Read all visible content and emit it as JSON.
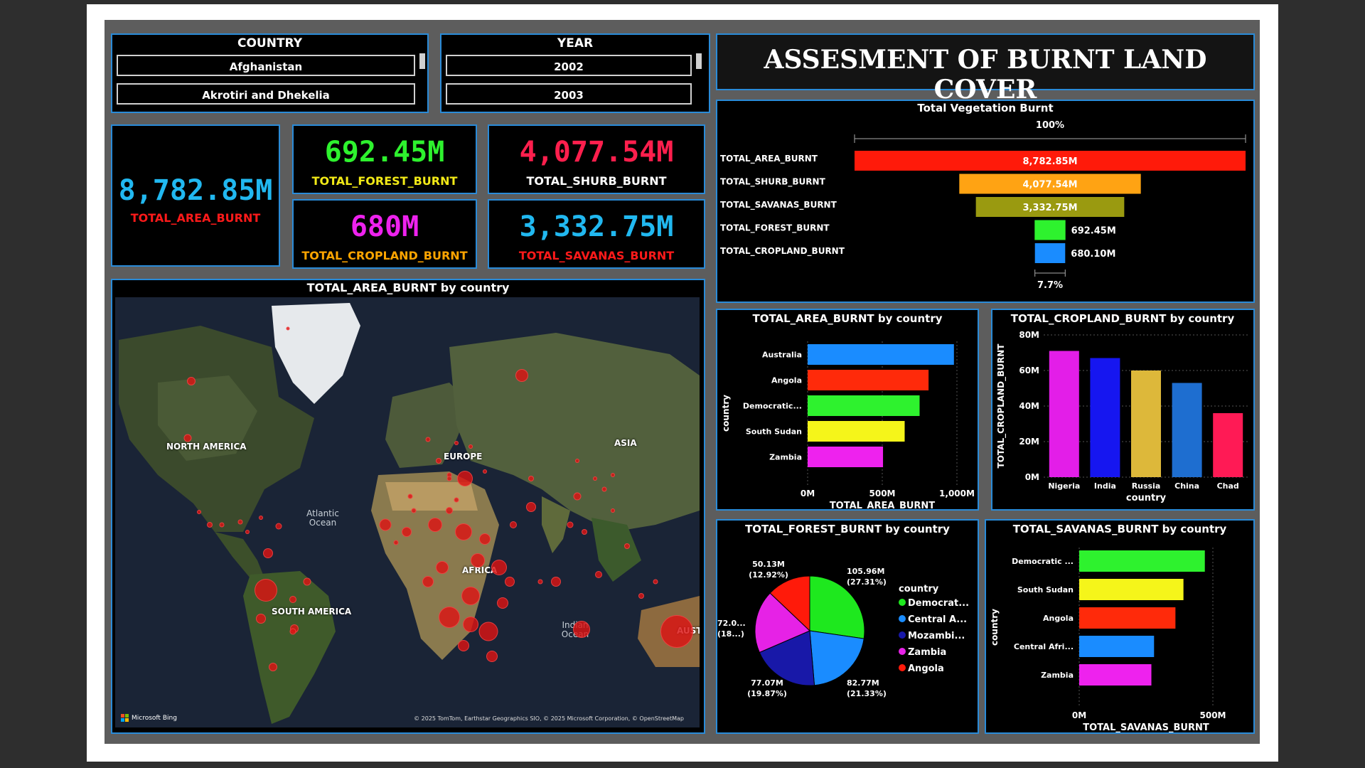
{
  "dashboard_title": "ASSESMENT OF BURNT LAND COVER",
  "slicers": {
    "country": {
      "title": "COUNTRY",
      "items": [
        "Afghanistan",
        "Akrotiri and Dhekelia"
      ]
    },
    "year": {
      "title": "YEAR",
      "items": [
        "2002",
        "2003"
      ]
    }
  },
  "kpis": {
    "area": {
      "value": "8,782.85M",
      "label": "TOTAL_AREA_BURNT",
      "value_color": "#21b8f0",
      "label_color": "#ff1a1a"
    },
    "forest": {
      "value": "692.45M",
      "label": "TOTAL_FOREST_BURNT",
      "value_color": "#2ef22e",
      "label_color": "#f2ea17"
    },
    "shrub": {
      "value": "4,077.54M",
      "label": "TOTAL_SHURB_BURNT",
      "value_color": "#ff1f4d",
      "label_color": "#ffffff"
    },
    "cropland": {
      "value": "680M",
      "label": "TOTAL_CROPLAND_BURNT",
      "value_color": "#ee22ee",
      "label_color": "#ffa500"
    },
    "savanas": {
      "value": "3,332.75M",
      "label": "TOTAL_SAVANAS_BURNT",
      "value_color": "#21b8f0",
      "label_color": "#ff1a1a"
    }
  },
  "map": {
    "title": "TOTAL_AREA_BURNT by country",
    "labels": {
      "north_america": "NORTH AMERICA",
      "europe": "EUROPE",
      "asia": "ASIA",
      "africa": "AFRICA",
      "south_america": "SOUTH AMERICA",
      "australia": "AUSTR",
      "atlantic": "Atlantic Ocean",
      "indian": "Indian Ocean"
    },
    "logo": "Microsoft Bing",
    "attribution": "© 2025 TomTom, Earthstar Geographics SIO, © 2025 Microsoft Corporation, © OpenStreetMap"
  },
  "chart_data": [
    {
      "type": "bar",
      "title": "Total Vegetation Burnt",
      "top_label": "100%",
      "bottom_label": "7.7%",
      "categories": [
        "TOTAL_AREA_BURNT",
        "TOTAL_SHURB_BURNT",
        "TOTAL_SAVANAS_BURNT",
        "TOTAL_FOREST_BURNT",
        "TOTAL_CROPLAND_BURNT"
      ],
      "values": [
        8782.85,
        4077.54,
        3332.75,
        692.45,
        680.1
      ],
      "value_labels": [
        "8,782.85M",
        "4,077.54M",
        "3,332.75M",
        "692.45M",
        "680.10M"
      ],
      "colors": [
        "#ff1a0a",
        "#ffa313",
        "#9a9a10",
        "#2ef22e",
        "#1a8cff"
      ]
    },
    {
      "type": "bar",
      "title": "TOTAL_AREA_BURNT by country",
      "categories": [
        "Australia",
        "Angola",
        "Democratic...",
        "South Sudan",
        "Zambia"
      ],
      "values": [
        980,
        810,
        750,
        650,
        505
      ],
      "colors": [
        "#1a8cff",
        "#ff2a0a",
        "#2ef22e",
        "#f5f51a",
        "#ee22ee"
      ],
      "xlabel": "TOTAL_AREA_BURNT",
      "ylabel": "country",
      "ticks": [
        "0M",
        "500M",
        "1,000M"
      ],
      "xlim": [
        0,
        1000
      ]
    },
    {
      "type": "bar",
      "title": "TOTAL_CROPLAND_BURNT by country",
      "categories": [
        "Nigeria",
        "India",
        "Russia",
        "China",
        "Chad"
      ],
      "values": [
        71,
        67,
        60,
        53,
        36
      ],
      "colors": [
        "#e31ee8",
        "#1616f0",
        "#ddb83a",
        "#1e6ed0",
        "#ff1a55"
      ],
      "xlabel": "country",
      "ylabel": "TOTAL_CROPLAND_BURNT",
      "ticks": [
        "0M",
        "20M",
        "40M",
        "60M",
        "80M"
      ],
      "ylim": [
        0,
        80
      ]
    },
    {
      "type": "pie",
      "title": "TOTAL_FOREST_BURNT by country",
      "legend_title": "country",
      "labels": [
        "Democrat...",
        "Central A...",
        "Mozambi...",
        "Zambia",
        "Angola"
      ],
      "values": [
        105.96,
        82.77,
        77.07,
        72.0,
        50.13
      ],
      "slice_labels": [
        "105.96M\n(27.31%)",
        "82.77M\n(21.33%)",
        "77.07M\n(19.87%)",
        "72.0...\n(18...)",
        "50.13M\n(12.92%)"
      ],
      "colors": [
        "#1ee81e",
        "#1a8cff",
        "#1818a8",
        "#e622e6",
        "#ff1a0a"
      ]
    },
    {
      "type": "bar",
      "title": "TOTAL_SAVANAS_BURNT by country",
      "categories": [
        "Democratic ...",
        "South Sudan",
        "Angola",
        "Central Afri...",
        "Zambia"
      ],
      "values": [
        470,
        390,
        360,
        280,
        270
      ],
      "colors": [
        "#2ef22e",
        "#f5f51a",
        "#ff2a0a",
        "#1a8cff",
        "#ee22ee"
      ],
      "xlabel": "TOTAL_SAVANAS_BURNT",
      "ylabel": "country",
      "ticks": [
        "0M",
        "500M"
      ],
      "xlim": [
        0,
        500
      ]
    }
  ]
}
